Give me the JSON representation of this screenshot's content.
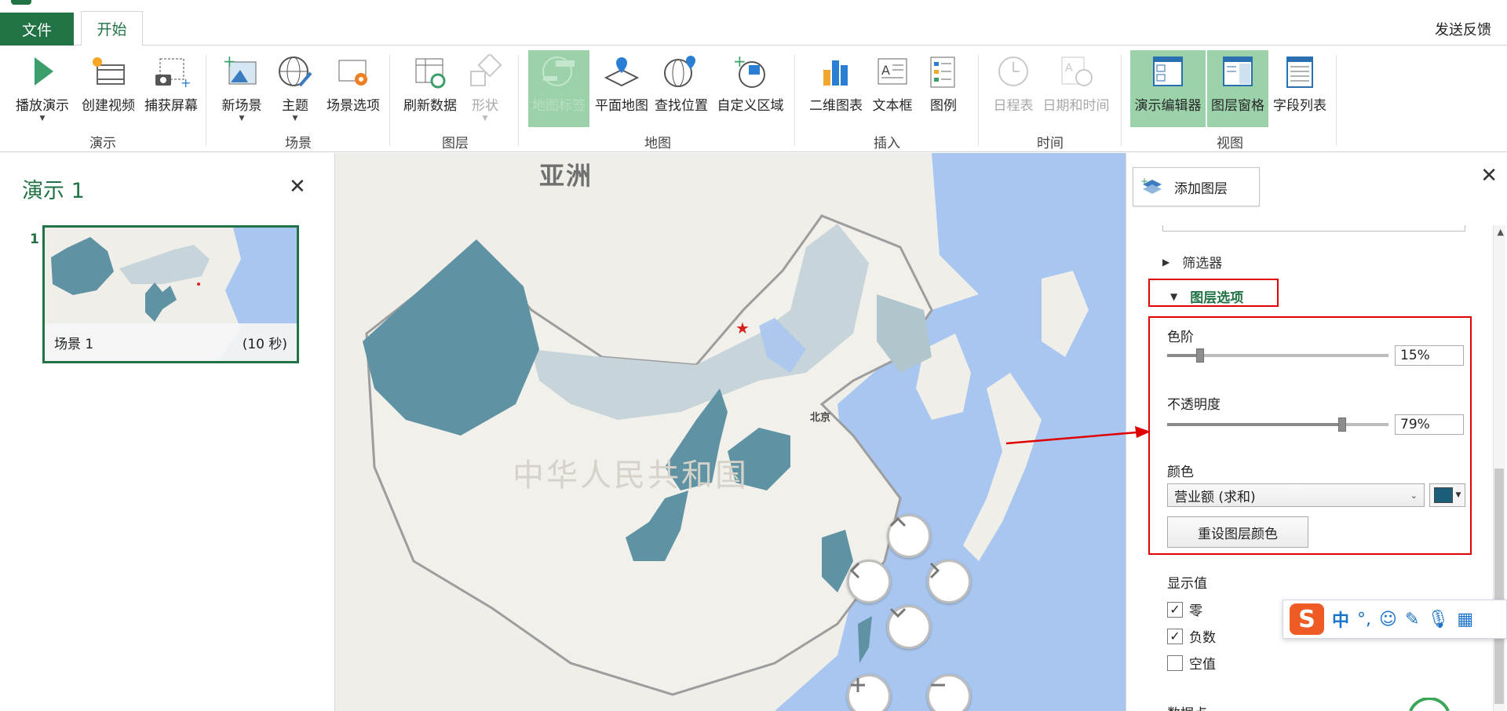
{
  "tabs": {
    "file": "文件",
    "home": "开始",
    "feedback": "发送反馈"
  },
  "ribbon": {
    "groups": {
      "tour": "演示",
      "scene": "场景",
      "layer": "图层",
      "map": "地图",
      "insert": "插入",
      "time": "时间",
      "view": "视图"
    },
    "buttons": {
      "play_tour": "播放演示",
      "create_video": "创建视频",
      "capture_screen": "捕获屏幕",
      "new_scene": "新场景",
      "themes": "主题",
      "scene_options": "场景选项",
      "refresh_data": "刷新数据",
      "shapes": "形状",
      "map_labels": "地图标签",
      "flat_map": "平面地图",
      "find_location": "查找位置",
      "custom_regions": "自定义区域",
      "2d_chart": "二维图表",
      "text_box": "文本框",
      "legend": "图例",
      "timeline": "日程表",
      "date_time": "日期和时间",
      "tour_editor": "演示编辑器",
      "layer_pane": "图层窗格",
      "field_list": "字段列表"
    }
  },
  "tour_panel": {
    "title": "演示 1",
    "scene_number": "1",
    "scene_name": "场景 1",
    "scene_duration": "(10 秒)"
  },
  "map": {
    "continent_label": "亚洲",
    "country_label": "中华人民共和国",
    "capital_label": "北京",
    "region_fill_color": "#5f93a4",
    "light_region_color": "#c7d5da",
    "land_color": "#efeee9",
    "water_color": "#a8c6ef"
  },
  "layer_pane": {
    "add_layer": "添加图层",
    "filters": "筛选器",
    "layer_options": "图层选项",
    "color_scale_label": "色阶",
    "color_scale_value": "15%",
    "color_scale_fraction": 0.15,
    "opacity_label": "不透明度",
    "opacity_value": "79%",
    "opacity_fraction": 0.79,
    "color_label": "颜色",
    "color_field": "营业额 (求和)",
    "swatch_color": "#1b5e7a",
    "reset_color": "重设图层颜色",
    "display_values_label": "显示值",
    "show_zero": "零",
    "show_negative": "负数",
    "show_null": "空值",
    "data_cut": "数据点"
  },
  "ime": {
    "mode": "中",
    "logo": "S"
  },
  "colors": {
    "accent": "#217346",
    "highlight": "#e00000",
    "active_button": "#9bd2a9"
  }
}
